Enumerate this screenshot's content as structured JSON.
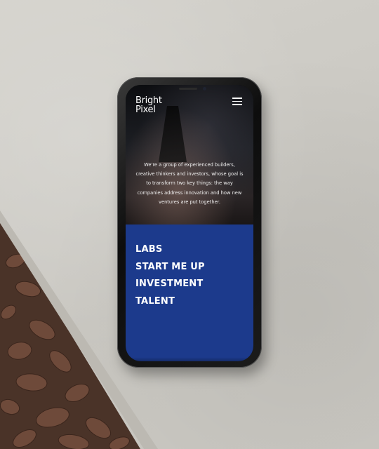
{
  "site": {
    "logo_line1": "Bright",
    "logo_line2": "Pixel"
  },
  "header": {
    "menu_icon": "hamburger-menu-icon"
  },
  "hero": {
    "tagline": "We're a group of experienced builders, creative thinkers and investors, whose goal is to transform two key things: the way companies address innovation and how new ventures are put together."
  },
  "nav": {
    "items": [
      {
        "label": "LABS"
      },
      {
        "label": "START ME UP"
      },
      {
        "label": "INVESTMENT"
      },
      {
        "label": "TALENT"
      }
    ]
  },
  "colors": {
    "accent_blue": "#1c3a8c",
    "hero_dark": "#0c0d10",
    "text_white": "#ffffff"
  }
}
